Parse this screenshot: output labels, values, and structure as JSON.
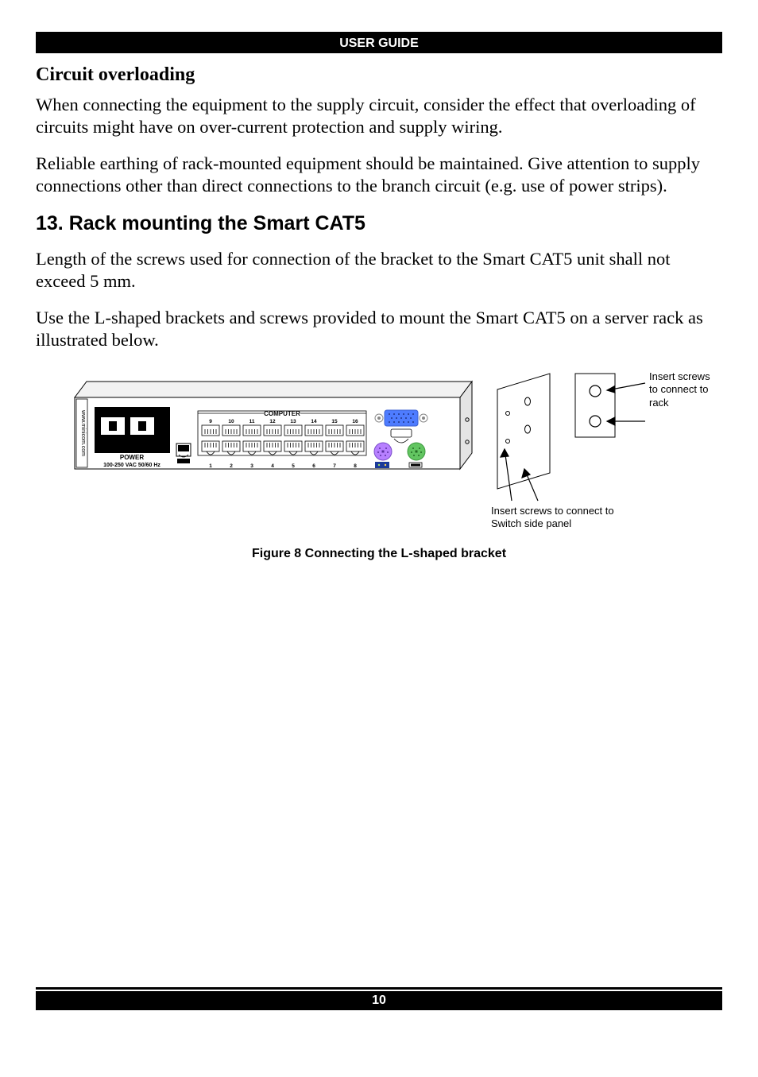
{
  "header": {
    "title": "USER GUIDE"
  },
  "footer": {
    "page_number": "10"
  },
  "section_circuit": {
    "heading": "Circuit overloading",
    "para1": "When connecting the equipment to the supply circuit, consider the effect that overloading of circuits might have on over-current protection and supply wiring.",
    "para2": "Reliable earthing of rack-mounted equipment should be maintained. Give attention to supply connections other than direct connections to the branch circuit (e.g. use of power strips)."
  },
  "section_rack": {
    "heading": "13. Rack mounting the Smart CAT5",
    "para1": "Length of the screws used for connection of the bracket to the Smart CAT5 unit shall not exceed 5 mm.",
    "para2": "Use the L-shaped brackets and screws provided to mount the Smart CAT5 on a server rack as illustrated below."
  },
  "figure": {
    "device": {
      "side_text": "www.minicom.com",
      "panel_label_computer": "COMPUTER",
      "panel_label_power": "POWER",
      "panel_power_rating": "100-250 VAC 50/60 Hz",
      "ports_top": [
        "9",
        "10",
        "11",
        "12",
        "13",
        "14",
        "15",
        "16"
      ],
      "ports_bottom": [
        "1",
        "2",
        "3",
        "4",
        "5",
        "6",
        "7",
        "8"
      ]
    },
    "callouts": {
      "to_rack": "Insert screws to connect to rack",
      "to_side_panel": "Insert screws to connect to Switch side panel"
    },
    "caption": "Figure 8 Connecting the L-shaped bracket"
  }
}
